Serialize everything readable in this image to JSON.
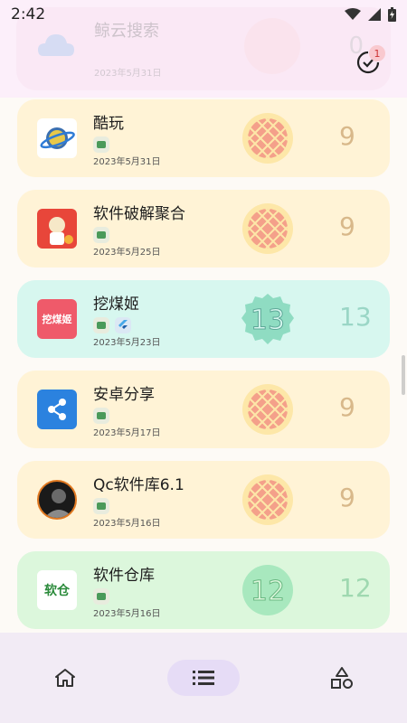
{
  "status": {
    "time": "2:42"
  },
  "ghost": {
    "title": "鲸云搜索",
    "date": "2023年5月31日",
    "number": "0"
  },
  "check_badge": {
    "count": "1"
  },
  "items": [
    {
      "name": "酷玩",
      "date": "2023年5月31日",
      "number": "9",
      "bg": "#fff3d6",
      "badge": "pie-icon",
      "tags": [
        "android-icon"
      ]
    },
    {
      "name": "软件破解聚合",
      "date": "2023年5月25日",
      "number": "9",
      "bg": "#fff3d6",
      "badge": "pie-icon",
      "tags": [
        "android-icon"
      ]
    },
    {
      "name": "挖煤姬",
      "date": "2023年5月23日",
      "number": "13",
      "bg": "#d7f7ef",
      "badge": "android-13-icon",
      "tags": [
        "android-icon",
        "flutter-icon"
      ]
    },
    {
      "name": "安卓分享",
      "date": "2023年5月17日",
      "number": "9",
      "bg": "#fff3d6",
      "badge": "pie-icon",
      "tags": [
        "android-icon"
      ]
    },
    {
      "name": "Qc软件库6.1",
      "date": "2023年5月16日",
      "number": "9",
      "bg": "#fff3d6",
      "badge": "pie-icon",
      "tags": [
        "android-icon"
      ]
    },
    {
      "name": "软件仓库",
      "date": "2023年5月16日",
      "number": "12",
      "bg": "#dcf7dc",
      "badge": "android-12-icon",
      "tags": [
        "android-icon"
      ]
    }
  ],
  "nav": [
    {
      "icon": "home-icon"
    },
    {
      "icon": "list-icon",
      "active": true
    },
    {
      "icon": "shapes-icon"
    }
  ],
  "logo_texts": {
    "item3": "挖煤姬",
    "item6": "软仓"
  }
}
